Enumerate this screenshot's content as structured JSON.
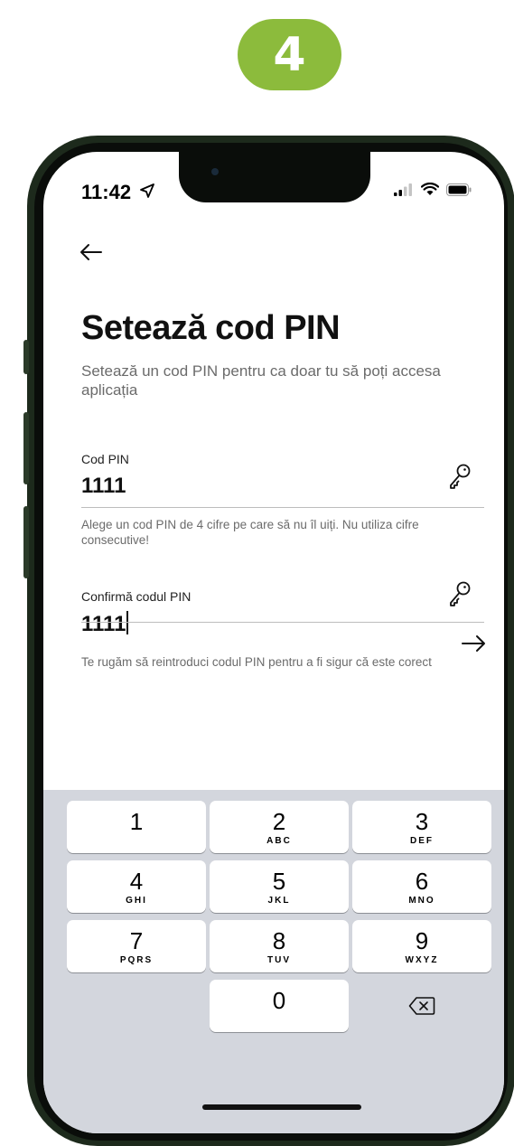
{
  "step_number": "4",
  "status_bar": {
    "time": "11:42"
  },
  "page": {
    "title": "Setează cod PIN",
    "subtitle": "Setează un cod PIN pentru ca doar tu să poți accesa aplicația"
  },
  "pin_field": {
    "label": "Cod PIN",
    "value": "1111",
    "helper": "Alege un cod PIN de 4 cifre pe care să nu îl uiți. Nu utiliza cifre consecutive!"
  },
  "confirm_field": {
    "label": "Confirmă codul PIN",
    "value": "1111",
    "helper": "Te rugăm să reintroduci codul PIN pentru a fi sigur că este corect"
  },
  "keypad": {
    "keys": [
      {
        "num": "1",
        "letters": ""
      },
      {
        "num": "2",
        "letters": "ABC"
      },
      {
        "num": "3",
        "letters": "DEF"
      },
      {
        "num": "4",
        "letters": "GHI"
      },
      {
        "num": "5",
        "letters": "JKL"
      },
      {
        "num": "6",
        "letters": "MNO"
      },
      {
        "num": "7",
        "letters": "PQRS"
      },
      {
        "num": "8",
        "letters": "TUV"
      },
      {
        "num": "9",
        "letters": "WXYZ"
      },
      {
        "num": "0",
        "letters": ""
      }
    ]
  },
  "colors": {
    "step_badge": "#8cbb3c",
    "phone_frame": "#1d2a1c",
    "keyboard_bg": "#d3d6dd"
  }
}
